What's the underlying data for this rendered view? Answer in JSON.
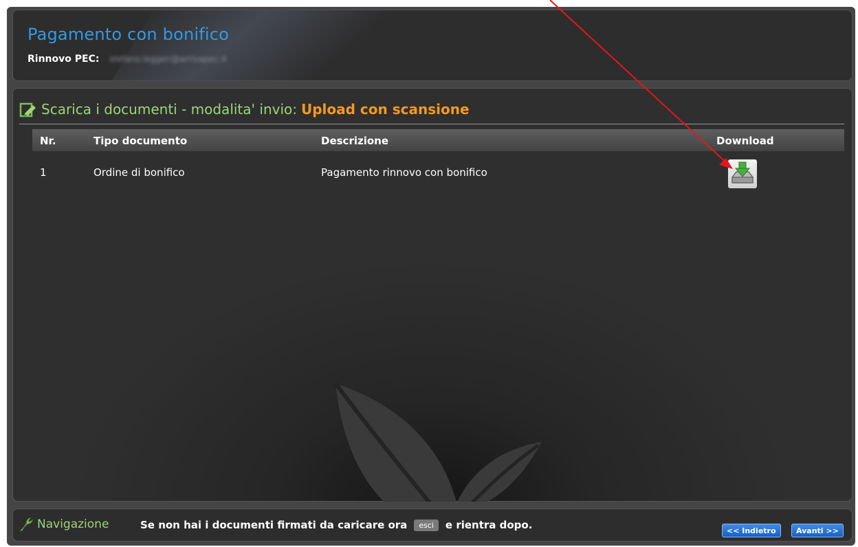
{
  "header": {
    "title": "Pagamento con bonifico",
    "subtitle_label": "Rinnovo PEC:",
    "subtitle_value_redacted": "stefano.leggeri@arrivapec.it"
  },
  "section": {
    "title_prefix": "Scarica i documenti - modalita' invio:",
    "title_highlight": "Upload con scansione"
  },
  "table": {
    "headers": [
      "Nr.",
      "Tipo documento",
      "Descrizione",
      "Download"
    ],
    "rows": [
      {
        "nr": "1",
        "tipo": "Ordine di bonifico",
        "descrizione": "Pagamento rinnovo con bonifico",
        "download_icon": "download-icon"
      }
    ]
  },
  "navigation": {
    "title": "Navigazione",
    "text_before": "Se non hai i documenti firmati da caricare ora",
    "esci_label": "esci",
    "text_after": "e rientra dopo.",
    "back_label": "<< Indietro",
    "next_label": "Avanti >>"
  },
  "colors": {
    "title_blue": "#2f9ae8",
    "section_green": "#9dd47a",
    "highlight_orange": "#f39a1f",
    "annotation_red": "#e8141c"
  },
  "icons": {
    "section": "edit-document-icon",
    "navigation": "wrench-icon",
    "download": "download-icon"
  }
}
